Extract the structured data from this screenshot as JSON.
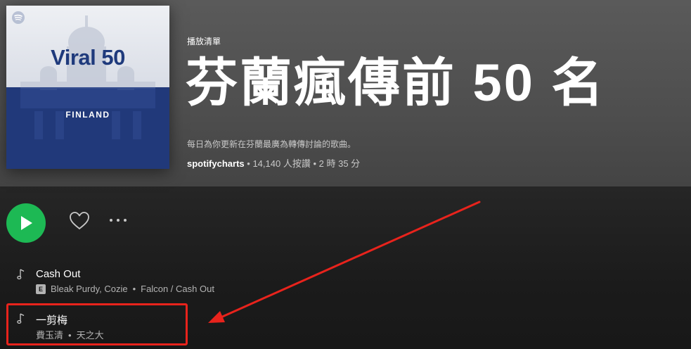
{
  "playlist": {
    "type_label": "播放清單",
    "title": "芬蘭瘋傳前 50 名",
    "description": "每日為你更新在芬蘭最廣為轉傳討論的歌曲。",
    "owner": "spotifycharts",
    "likes": "14,140 人按讚",
    "duration": "2 時 35 分",
    "separator": "•"
  },
  "cover": {
    "title": "Viral 50",
    "subtitle": "FINLAND",
    "top_color": "#e4e7ee",
    "bottom_color": "#21397a"
  },
  "actions": {
    "play_icon": "play-icon",
    "like_icon": "heart-icon",
    "more_icon": "more-icon",
    "accent": "#1db954"
  },
  "tracks": [
    {
      "name": "Cash Out",
      "explicit_badge": "E",
      "artists": "Bleak Purdy, Cozie",
      "album": "Falcon / Cash Out"
    },
    {
      "name": "一剪梅",
      "artists": "費玉清",
      "album": "天之大"
    }
  ],
  "annotation": {
    "color": "#e8231c"
  }
}
